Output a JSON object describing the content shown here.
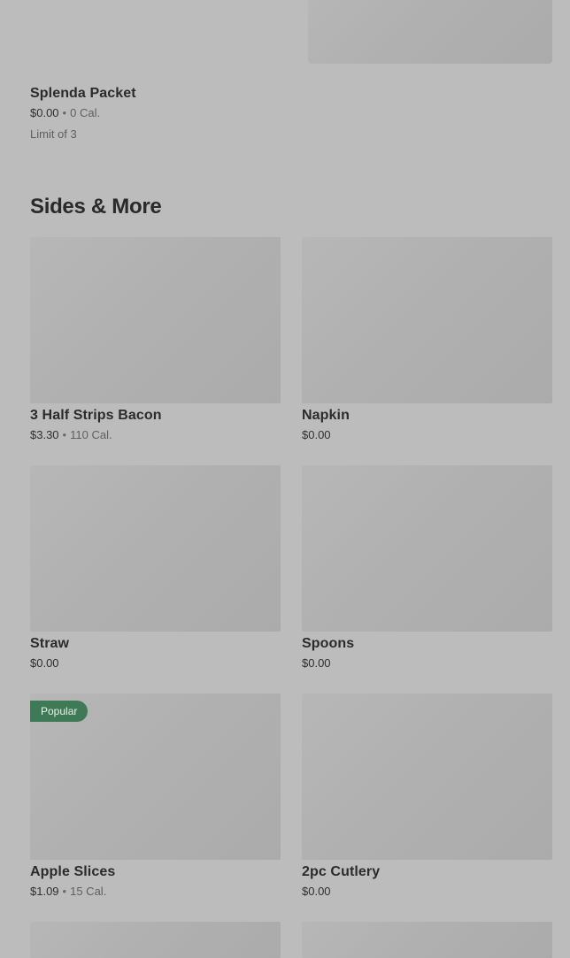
{
  "top_item": {
    "name": "Splenda Packet",
    "price": "$0.00",
    "calories": "0 Cal.",
    "limit": "Limit of 3"
  },
  "section": {
    "title": "Sides & More"
  },
  "items": [
    {
      "name": "3 Half Strips Bacon",
      "price": "$3.30",
      "calories": "110 Cal.",
      "badge": ""
    },
    {
      "name": "Napkin",
      "price": "$0.00",
      "calories": "",
      "badge": ""
    },
    {
      "name": "Straw",
      "price": "$0.00",
      "calories": "",
      "badge": ""
    },
    {
      "name": "Spoons",
      "price": "$0.00",
      "calories": "",
      "badge": ""
    },
    {
      "name": "Apple Slices",
      "price": "$1.09",
      "calories": "15 Cal.",
      "badge": "Popular"
    },
    {
      "name": "2pc Cutlery",
      "price": "$0.00",
      "calories": "",
      "badge": ""
    }
  ],
  "colors": {
    "background": "#bcbcbc",
    "badge": "#3f7a57"
  }
}
